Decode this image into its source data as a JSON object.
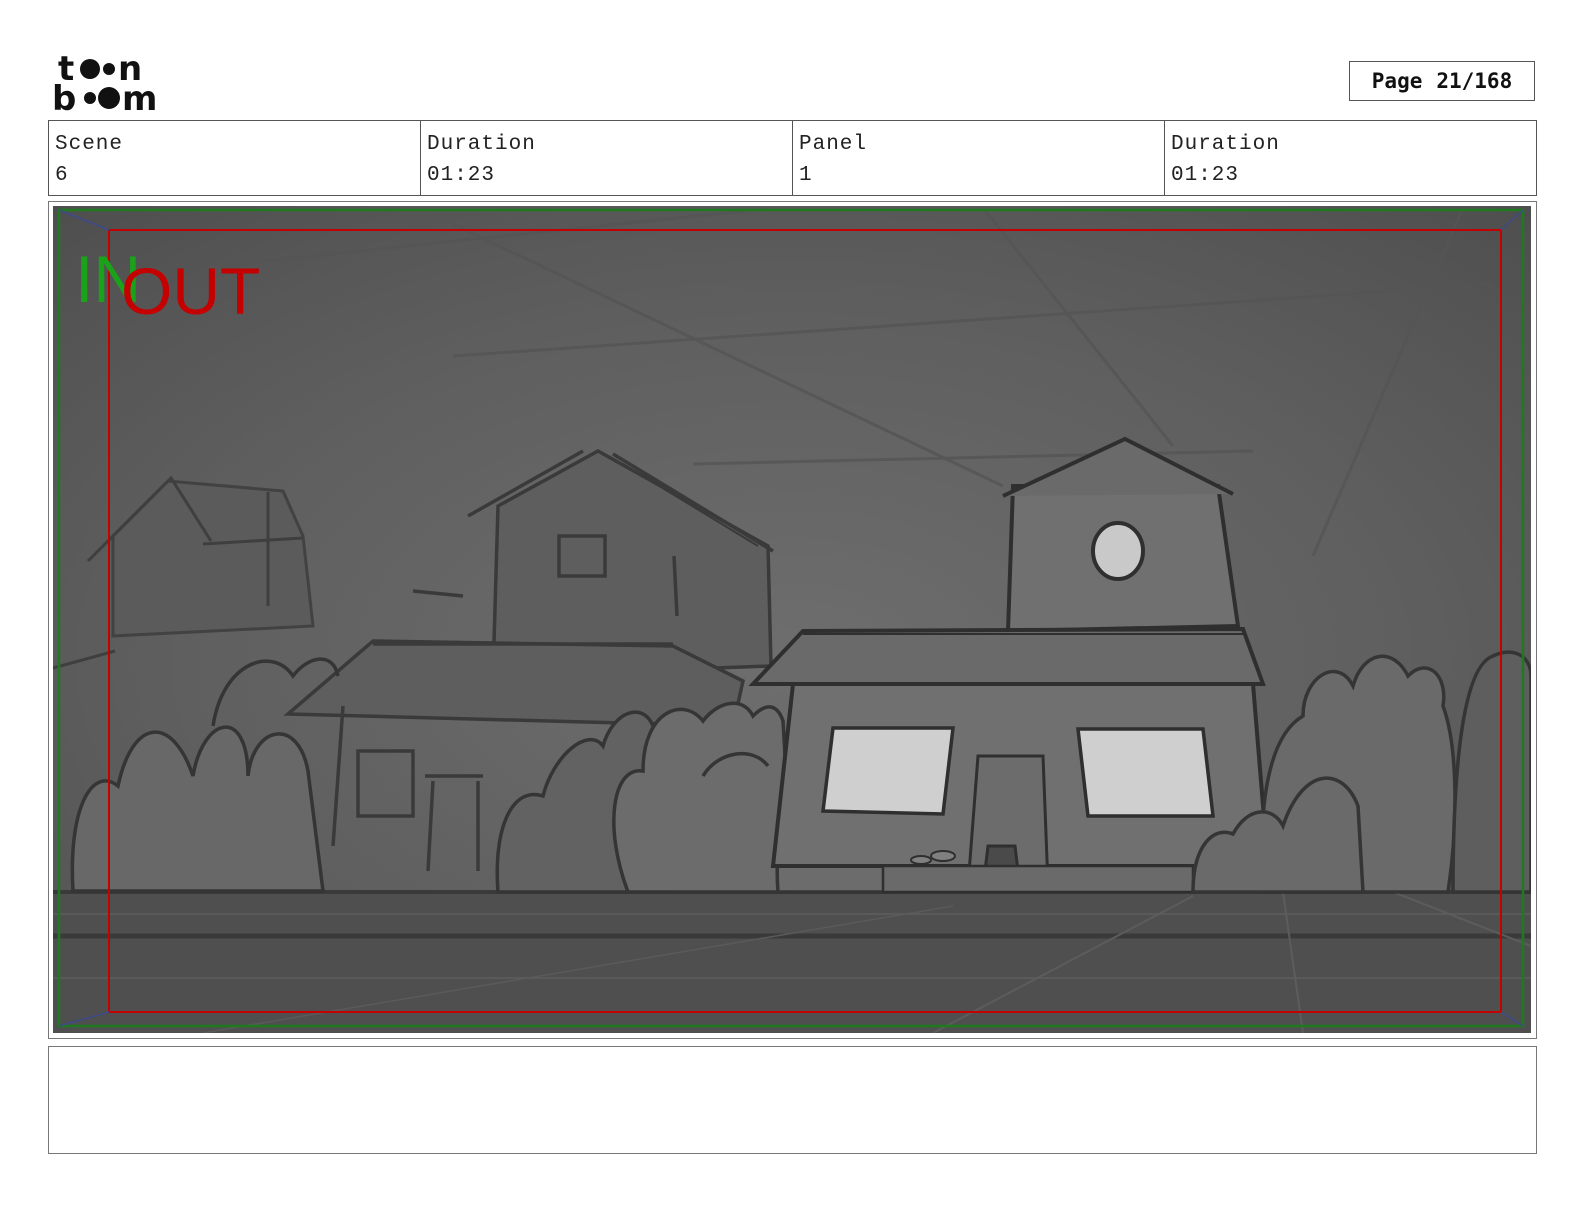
{
  "header": {
    "page_label": "Page",
    "page_number": "21/168"
  },
  "info": {
    "scene_label": "Scene",
    "scene_value": "6",
    "scene_duration_label": "Duration",
    "scene_duration_value": "01:23",
    "panel_label": "Panel",
    "panel_value": "1",
    "panel_duration_label": "Duration",
    "panel_duration_value": "01:23"
  },
  "panel": {
    "in_marker": "IN",
    "out_marker": "OUT"
  },
  "caption": {
    "text": ""
  },
  "colors": {
    "in_marker": "#1aa31a",
    "out_marker": "#c40000",
    "border": "#555555"
  }
}
